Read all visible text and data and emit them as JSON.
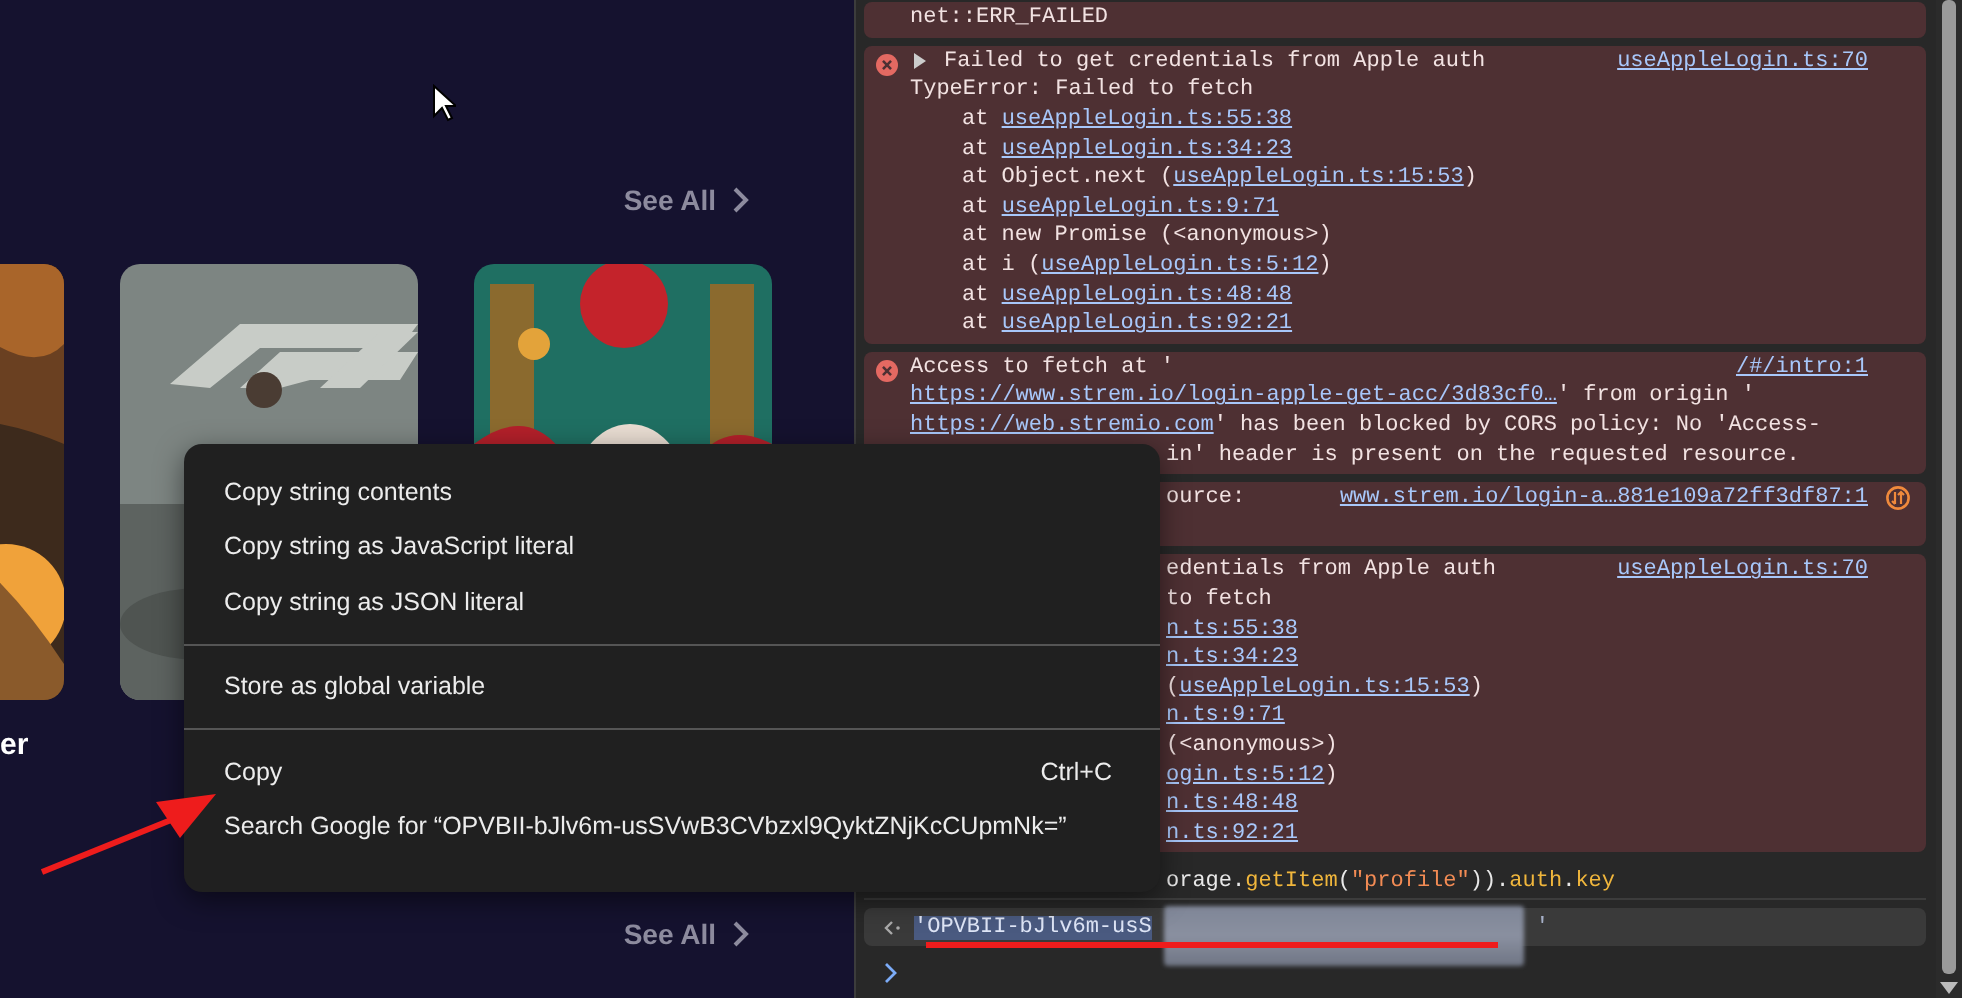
{
  "browse": {
    "see_all": [
      "See All",
      "See All"
    ],
    "posters": [
      {
        "kind": "picture"
      },
      {
        "kind": "picture"
      },
      {
        "kind": "picture"
      }
    ],
    "title_fragment": "er"
  },
  "context_menu": {
    "groups": [
      [
        {
          "label": "Copy string contents"
        },
        {
          "label": "Copy string as JavaScript literal"
        },
        {
          "label": "Copy string as JSON literal"
        }
      ],
      [
        {
          "label": "Store as global variable"
        }
      ],
      [
        {
          "label": "Copy",
          "shortcut": "Ctrl+C"
        },
        {
          "label": "Search Google for “OPVBII-bJlv6m-usSVwB3CVbzxl9QyktZNjKcCUpmNk=”"
        }
      ]
    ]
  },
  "console": {
    "entries": [
      {
        "kind": "plain",
        "lines": [
          {
            "kind": "text",
            "segs": [
              {
                "kind": "text",
                "t": "net::ERR_FAILED"
              }
            ]
          }
        ]
      },
      {
        "kind": "error",
        "source": "useAppleLogin.ts:70",
        "lines": [
          {
            "kind": "head",
            "expanded": false,
            "segs": [
              {
                "kind": "text",
                "t": "Failed to get credentials from Apple auth"
              }
            ]
          },
          {
            "kind": "text",
            "segs": [
              {
                "kind": "text",
                "t": "TypeError: Failed to fetch"
              }
            ]
          },
          {
            "kind": "stack",
            "segs": [
              {
                "kind": "text",
                "t": "at "
              },
              {
                "kind": "link",
                "t": "useAppleLogin.ts:55:38"
              }
            ]
          },
          {
            "kind": "stack",
            "segs": [
              {
                "kind": "text",
                "t": "at "
              },
              {
                "kind": "link",
                "t": "useAppleLogin.ts:34:23"
              }
            ]
          },
          {
            "kind": "stack",
            "segs": [
              {
                "kind": "text",
                "t": "at Object.next ("
              },
              {
                "kind": "link",
                "t": "useAppleLogin.ts:15:53"
              },
              {
                "kind": "text",
                "t": ")"
              }
            ]
          },
          {
            "kind": "stack",
            "segs": [
              {
                "kind": "text",
                "t": "at "
              },
              {
                "kind": "link",
                "t": "useAppleLogin.ts:9:71"
              }
            ]
          },
          {
            "kind": "stack",
            "segs": [
              {
                "kind": "text",
                "t": "at new Promise (<anonymous>)"
              }
            ]
          },
          {
            "kind": "stack",
            "segs": [
              {
                "kind": "text",
                "t": "at i ("
              },
              {
                "kind": "link",
                "t": "useAppleLogin.ts:5:12"
              },
              {
                "kind": "text",
                "t": ")"
              }
            ]
          },
          {
            "kind": "stack",
            "segs": [
              {
                "kind": "text",
                "t": "at "
              },
              {
                "kind": "link",
                "t": "useAppleLogin.ts:48:48"
              }
            ]
          },
          {
            "kind": "stack",
            "segs": [
              {
                "kind": "text",
                "t": "at "
              },
              {
                "kind": "link",
                "t": "useAppleLogin.ts:92:21"
              }
            ]
          }
        ]
      },
      {
        "kind": "error",
        "source": "/#/intro:1",
        "lines": [
          {
            "kind": "text",
            "segs": [
              {
                "kind": "text",
                "t": "Access to fetch at '"
              }
            ]
          },
          {
            "kind": "text",
            "segs": [
              {
                "kind": "link",
                "t": "https://www.strem.io/login-apple-get-acc/3d83cf0…"
              },
              {
                "kind": "text",
                "t": "' from origin '"
              }
            ]
          },
          {
            "kind": "text",
            "segs": [
              {
                "kind": "link",
                "t": "https://web.stremio.com"
              },
              {
                "kind": "text",
                "t": "' has been blocked by CORS policy: No 'Access-"
              }
            ]
          },
          {
            "kind": "clipped",
            "segs": [
              {
                "kind": "text",
                "t": "in' header is present on the requested resource."
              }
            ]
          }
        ]
      },
      {
        "kind": "resource",
        "source": "www.strem.io/login-a…881e109a72ff3df87:1",
        "lines": [
          {
            "kind": "clipped",
            "segs": [
              {
                "kind": "text",
                "t": "ource:"
              }
            ]
          },
          {
            "kind": "blank"
          }
        ]
      },
      {
        "kind": "plain",
        "source": "useAppleLogin.ts:70",
        "lines": [
          {
            "kind": "clipped",
            "segs": [
              {
                "kind": "text",
                "t": "edentials from Apple auth"
              }
            ]
          },
          {
            "kind": "clipped",
            "segs": [
              {
                "kind": "text",
                "t": "to fetch"
              }
            ]
          },
          {
            "kind": "clipped",
            "segs": [
              {
                "kind": "link",
                "t": "n.ts:55:38"
              }
            ]
          },
          {
            "kind": "clipped",
            "segs": [
              {
                "kind": "link",
                "t": "n.ts:34:23"
              }
            ]
          },
          {
            "kind": "clipped",
            "segs": [
              {
                "kind": "text",
                "t": "("
              },
              {
                "kind": "link",
                "t": "useAppleLogin.ts:15:53"
              },
              {
                "kind": "text",
                "t": ")"
              }
            ]
          },
          {
            "kind": "clipped",
            "segs": [
              {
                "kind": "link",
                "t": "n.ts:9:71"
              }
            ]
          },
          {
            "kind": "clipped",
            "segs": [
              {
                "kind": "text",
                "t": "(<anonymous>)"
              }
            ]
          },
          {
            "kind": "clipped",
            "segs": [
              {
                "kind": "link",
                "t": "ogin.ts:5:12"
              },
              {
                "kind": "text",
                "t": ")"
              }
            ]
          },
          {
            "kind": "clipped",
            "segs": [
              {
                "kind": "link",
                "t": "n.ts:48:48"
              }
            ]
          },
          {
            "kind": "clipped",
            "segs": [
              {
                "kind": "link",
                "t": "n.ts:92:21"
              }
            ]
          }
        ]
      }
    ],
    "input": [
      {
        "kind": "text",
        "t": "orage."
      },
      {
        "kind": "method",
        "t": "getItem"
      },
      {
        "kind": "text",
        "t": "("
      },
      {
        "kind": "string",
        "t": "\"profile\""
      },
      {
        "kind": "text",
        "t": "))."
      },
      {
        "kind": "method",
        "t": "auth"
      },
      {
        "kind": "text",
        "t": "."
      },
      {
        "kind": "method",
        "t": "key"
      }
    ],
    "result": {
      "value": "'OPVBII-bJlv6m-usS",
      "selected": true,
      "redacted": true,
      "value_end": "'"
    }
  },
  "annotations": {
    "arrow": true,
    "underline": true
  }
}
